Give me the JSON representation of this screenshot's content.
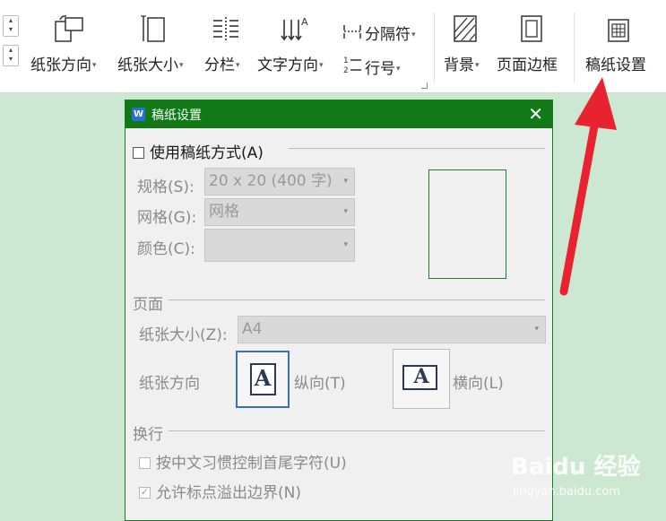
{
  "ribbon": {
    "paper_orientation": "纸张方向",
    "paper_size": "纸张大小",
    "columns": "分栏",
    "text_direction": "文字方向",
    "separator": "分隔符",
    "line_number": "行号",
    "background": "背景",
    "page_border": "页面边框",
    "manuscript_settings": "稿纸设置"
  },
  "dialog": {
    "title": "稿纸设置",
    "use_manuscript": "使用稿纸方式(A)",
    "spec_label": "规格(S):",
    "spec_value": "20 x 20 (400 字)",
    "grid_label": "网格(G):",
    "grid_value": "网格",
    "color_label": "颜色(C):",
    "color_value": "",
    "page_section": "页面",
    "paper_size_label": "纸张大小(Z):",
    "paper_size_value": "A4",
    "orientation_label": "纸张方向",
    "portrait": "纵向(T)",
    "landscape": "横向(L)",
    "wrap_section": "换行",
    "opt_chinese_habit": "按中文习惯控制首尾字符(U)",
    "opt_punct_overflow": "允许标点溢出边界(N)"
  },
  "watermark": {
    "brand": "Baidu 经验",
    "url": "jingyan.baidu.com"
  },
  "colors": {
    "titlebar": "#117a17",
    "arrow": "#e8232f",
    "workspace": "#cde8d2"
  }
}
